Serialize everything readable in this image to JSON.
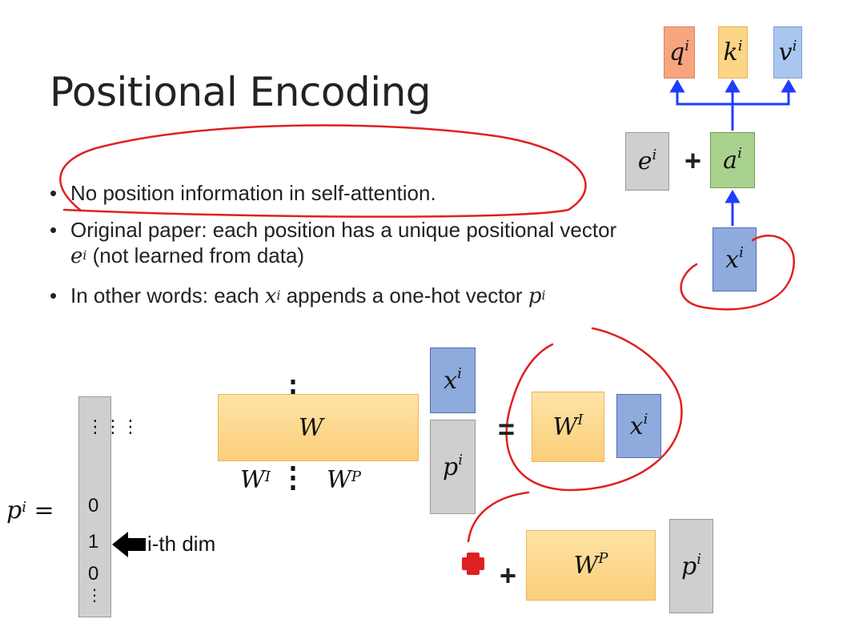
{
  "title": "Positional Encoding",
  "bullets": {
    "b1": "No position information in self-attention.",
    "b2_part1": "Original paper: each position has a unique positional vector ",
    "b2_part2": " (not learned from data)",
    "b3_part1": "In other words: each ",
    "b3_part2": " appends a one-hot vector "
  },
  "symbols": {
    "e": "e",
    "x": "x",
    "p": "p",
    "q": "q",
    "k": "k",
    "v": "v",
    "a": "a",
    "W": "W",
    "sup_i": "i",
    "sup_I": "I",
    "sup_P": "P"
  },
  "operators": {
    "plus": "+",
    "equals": "="
  },
  "vector": {
    "values": [
      "0",
      "1",
      "0"
    ],
    "dots_top": "⋮⋮⋮",
    "dots_bottom": "⋮"
  },
  "arrow_label": "i-th dim",
  "colors": {
    "q_box": "#f7a57f",
    "k_box": "#fcd586",
    "v_box": "#a9c6ee",
    "x_box": "#8faadc",
    "a_box": "#a9d18e",
    "e_box": "#cfcfcf",
    "w_box": "#fcce7a",
    "connector": "#1f3cff",
    "annotation": "#e02020"
  },
  "icons": [
    "black-left-arrow-icon",
    "red-cross-icon"
  ]
}
